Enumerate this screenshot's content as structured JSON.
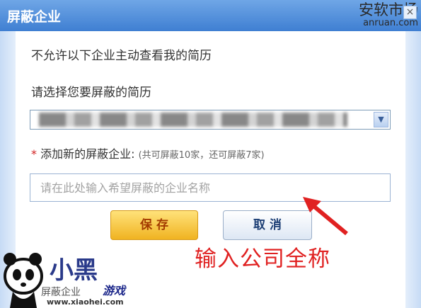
{
  "dialog": {
    "title": "屏蔽企业",
    "close_symbol": "×"
  },
  "watermark": {
    "name": "安软市场",
    "url": "anruan.com"
  },
  "form": {
    "deny_text": "不允许以下企业主动查看我的简历",
    "select_label": "请选择您要屏蔽的简历",
    "resume_select_value": "",
    "required_mark": "*",
    "add_label": "添加新的屏蔽企业:",
    "add_hint": "(共可屏蔽10家，还可屏蔽7家)",
    "company_input_value": "",
    "company_input_placeholder": "请在此处输入希望屏蔽的企业名称"
  },
  "buttons": {
    "save_label": "保 存",
    "cancel_label": "取 消"
  },
  "annotation": {
    "text": "输入公司全称",
    "arrow_icon": "red-arrow-icon"
  },
  "footer": {
    "partial_label": "屏蔽企业"
  },
  "logo": {
    "main": "小黑",
    "game": "游戏",
    "url": "www.xiaohei.com"
  },
  "colors": {
    "title_bar": "#4f8cdb",
    "save_button": "#f5c237",
    "annotation": "#e02121",
    "required": "#d21f1f"
  }
}
